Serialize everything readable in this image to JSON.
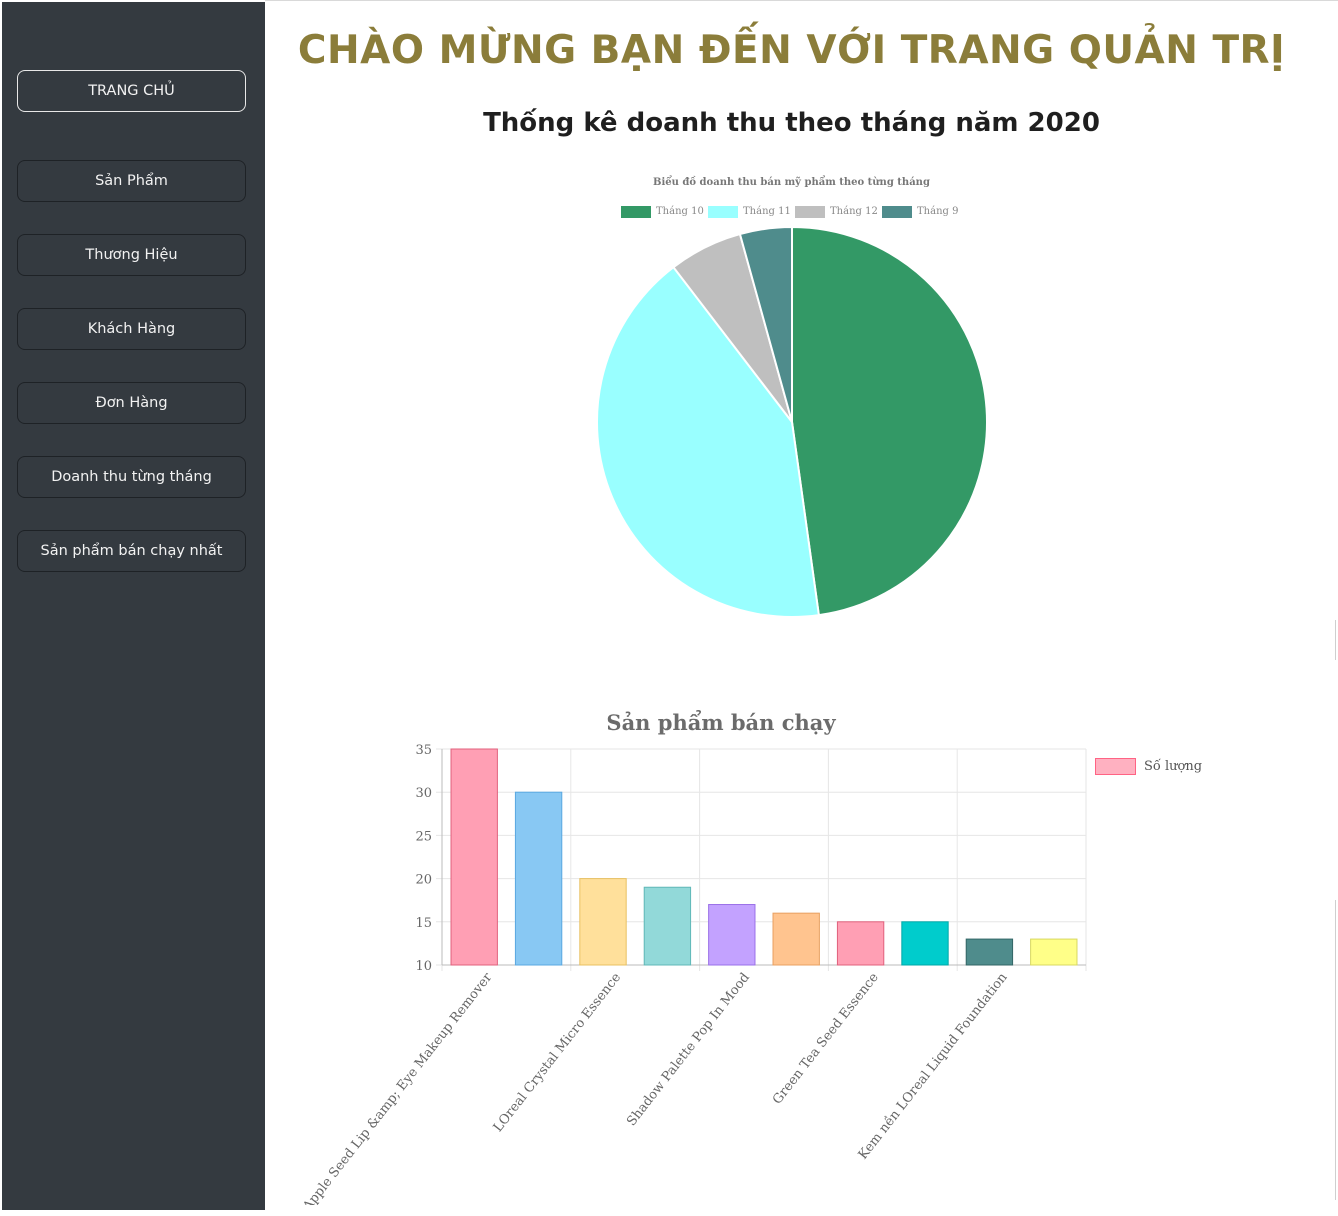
{
  "sidebar": {
    "items": [
      {
        "label": "TRANG CHỦ"
      },
      {
        "label": "Sản Phẩm"
      },
      {
        "label": "Thương Hiệu"
      },
      {
        "label": "Khách Hàng"
      },
      {
        "label": "Đơn Hàng"
      },
      {
        "label": "Doanh thu từng tháng"
      },
      {
        "label": "Sản phẩm bán chạy nhất"
      }
    ]
  },
  "header": {
    "welcome": "CHÀO MỪNG BẠN ĐẾN VỚI TRANG QUẢN TRỊ",
    "section_title": "Thống kê doanh thu theo tháng năm 2020"
  },
  "chart_data": [
    {
      "type": "pie",
      "title": "Biểu đồ doanh thu bán mỹ phẩm theo từng tháng",
      "legend_position": "top",
      "categories": [
        "Tháng 10",
        "Tháng 11",
        "Tháng 12",
        "Tháng 9"
      ],
      "values": [
        47.8,
        41.8,
        6.1,
        4.3
      ],
      "colors": [
        "#339966",
        "#99ffff",
        "#bfbfbf",
        "#4f8c8c"
      ]
    },
    {
      "type": "bar",
      "title": "Sản phẩm bán chạy",
      "legend_position": "right",
      "categories": [
        "Apple Seed Lip &amp; Eye Makeup Remover",
        "",
        "LOreal Crystal Micro Essence",
        "",
        "Shadow Palette Pop In Mood",
        "",
        "Green Tea Seed Essence",
        "",
        "Kem nền LOreal Liquid Foundation",
        ""
      ],
      "series": [
        {
          "name": "Số lượng",
          "values": [
            35,
            30,
            20,
            19,
            17,
            16,
            15,
            15,
            13,
            13
          ]
        }
      ],
      "ylim": [
        10,
        35
      ],
      "yticks": [
        10,
        15,
        20,
        25,
        30,
        35
      ],
      "grid": true,
      "bar_colors": [
        "#ff9fb4",
        "#88c8f3",
        "#ffe09b",
        "#92d9d9",
        "#c3a2ff",
        "#ffc48f",
        "#ff9fb4",
        "#00cccc",
        "#4f8c8c",
        "#ffff88"
      ],
      "bar_borders": [
        "#e0607c",
        "#5aa8e0",
        "#e8c060",
        "#60b8b8",
        "#9a70e8",
        "#e8a060",
        "#e0607c",
        "#00a8a8",
        "#336666",
        "#d8d860"
      ]
    }
  ]
}
